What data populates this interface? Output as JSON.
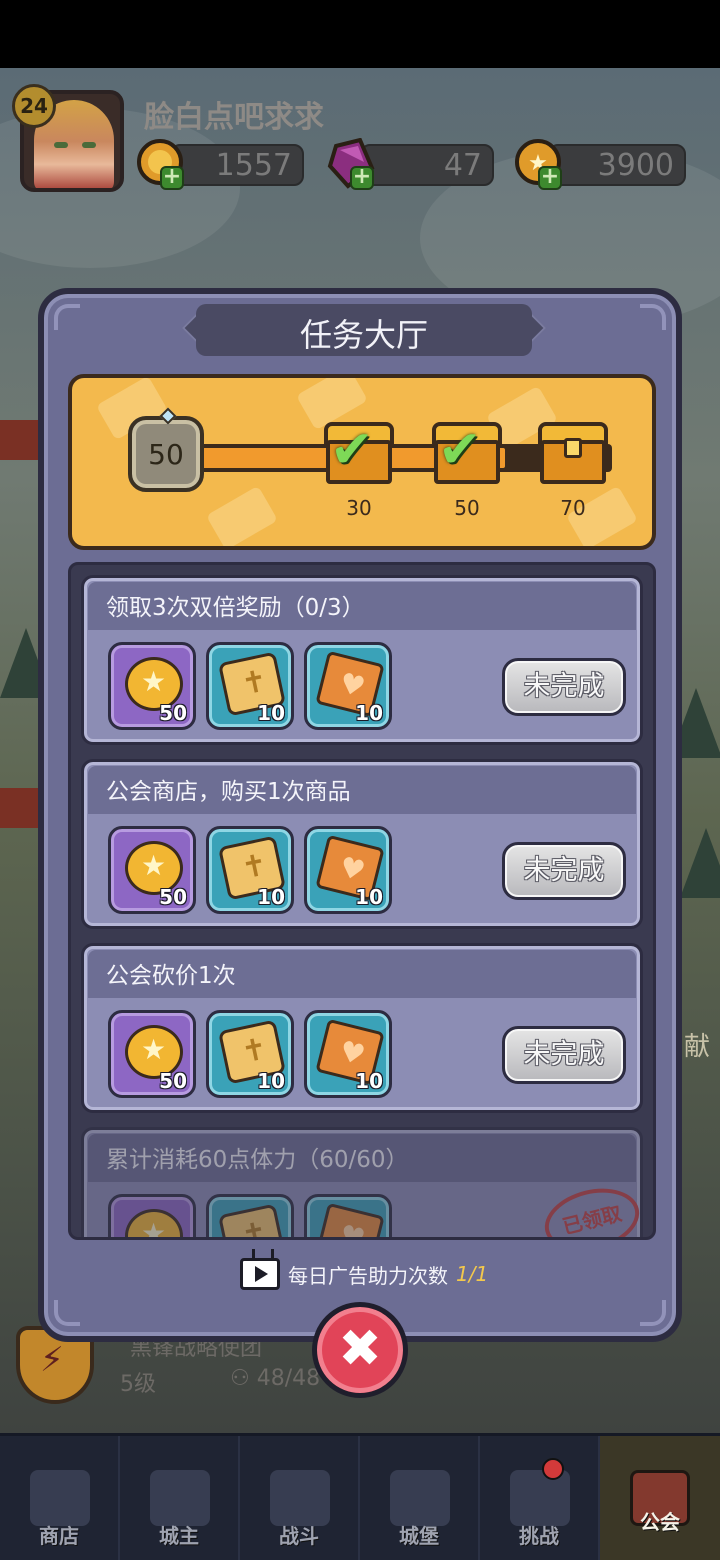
{
  "player": {
    "level": "24",
    "name": "脸白点吧求求"
  },
  "currencies": [
    {
      "name": "gold-coin",
      "value": "1557",
      "color": "#f2b632"
    },
    {
      "name": "purple-gem",
      "value": "47",
      "color": "#8b2e7f"
    },
    {
      "name": "guild-coin",
      "value": "3900",
      "color": "#f2b632"
    }
  ],
  "modal": {
    "title": "任务大厅",
    "progress": {
      "current": "50",
      "fill_fraction": 0.75,
      "milestones": [
        {
          "value": "30",
          "state": "claimed"
        },
        {
          "value": "50",
          "state": "claimed"
        },
        {
          "value": "70",
          "state": "locked"
        }
      ]
    },
    "tasks": [
      {
        "title": "领取3次双倍奖励（0/3）",
        "status": "未完成",
        "rewards": [
          {
            "icon": "coin-icon",
            "qty": "50"
          },
          {
            "icon": "scroll-icon",
            "qty": "10"
          },
          {
            "icon": "card-icon",
            "qty": "10"
          }
        ]
      },
      {
        "title": "公会商店，购买1次商品",
        "status": "未完成",
        "rewards": [
          {
            "icon": "coin-icon",
            "qty": "50"
          },
          {
            "icon": "scroll-icon",
            "qty": "10"
          },
          {
            "icon": "card-icon",
            "qty": "10"
          }
        ]
      },
      {
        "title": "公会砍价1次",
        "status": "未完成",
        "rewards": [
          {
            "icon": "coin-icon",
            "qty": "50"
          },
          {
            "icon": "scroll-icon",
            "qty": "10"
          },
          {
            "icon": "card-icon",
            "qty": "10"
          }
        ]
      },
      {
        "title": "累计消耗60点体力（60/60）",
        "status": "已领取",
        "rewards": []
      }
    ],
    "ad": {
      "label": "每日广告助力次数",
      "count": "1/1"
    }
  },
  "background": {
    "side_label": "献",
    "guild": {
      "name": "黑锋战略使团",
      "level": "5级",
      "members": "48/48"
    }
  },
  "nav": [
    {
      "label": "商店",
      "icon": "shop-icon"
    },
    {
      "label": "城主",
      "icon": "crown-icon"
    },
    {
      "label": "战斗",
      "icon": "swords-icon"
    },
    {
      "label": "城堡",
      "icon": "castle-icon"
    },
    {
      "label": "挑战",
      "icon": "demon-icon"
    },
    {
      "label": "公会",
      "icon": "guild-banner-icon",
      "active": true
    }
  ]
}
